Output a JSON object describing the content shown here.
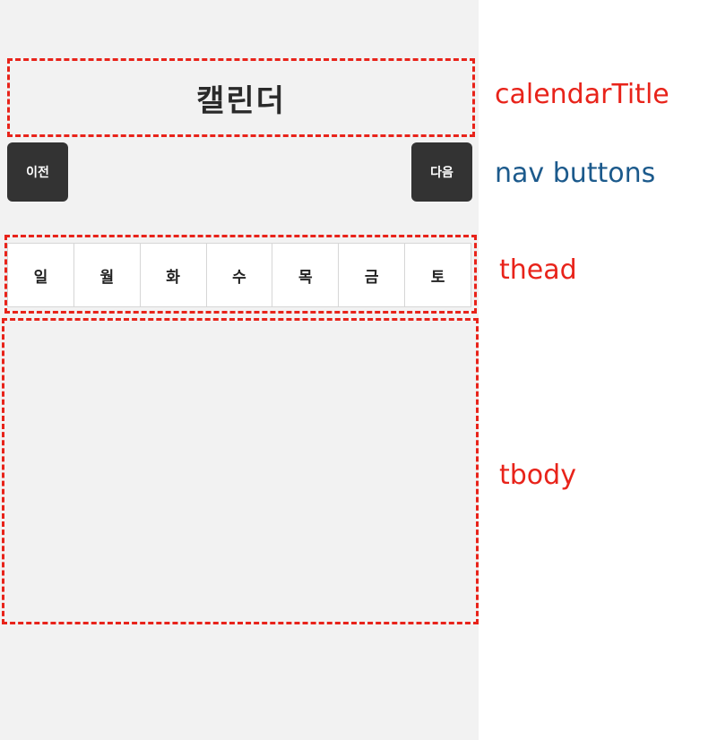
{
  "calendar": {
    "title": "캘린더",
    "prev_label": "이전",
    "next_label": "다음",
    "weekdays": [
      "일",
      "월",
      "화",
      "수",
      "목",
      "금",
      "토"
    ]
  },
  "annotations": {
    "title": {
      "text": "calendarTitle",
      "color": "#e8231a"
    },
    "nav": {
      "text": "nav buttons",
      "color": "#1c5a8c"
    },
    "thead": {
      "text": "thead",
      "color": "#e8231a"
    },
    "tbody": {
      "text": "tbody",
      "color": "#e8231a"
    }
  },
  "colors": {
    "panel_bg": "#f2f2f2",
    "button_bg": "#333333",
    "outline": "#e8231a"
  }
}
